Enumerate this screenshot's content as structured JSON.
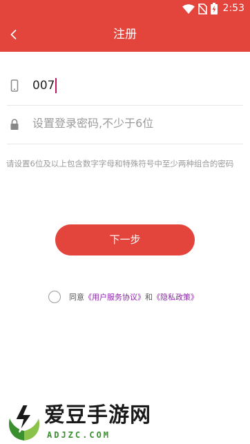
{
  "status_bar": {
    "time": "2:53",
    "icons": [
      "wifi-icon",
      "no-sim-icon",
      "battery-charging-icon"
    ]
  },
  "app_bar": {
    "title": "注册",
    "back_icon": "chevron-left-icon"
  },
  "form": {
    "phone": {
      "icon": "phone-icon",
      "value": "007"
    },
    "password": {
      "icon": "lock-icon",
      "placeholder": "设置登录密码,不少于6位"
    },
    "hint": "请设置6位及以上包含数字字母和特殊符号中至少两种组合的密码"
  },
  "next_button": {
    "label": "下一步"
  },
  "agreement": {
    "prefix": "同意",
    "user_agreement": "《用户服务协议》",
    "and": "和",
    "privacy_policy": "《隐私政策》"
  },
  "watermark": {
    "title": "爱豆手游网",
    "subtitle": "ADJZC.COM"
  },
  "colors": {
    "primary": "#e3443b",
    "link": "#8e24aa",
    "caret": "#c2185b",
    "placeholder": "#9a9a9a",
    "divider": "#e6e6e6"
  }
}
